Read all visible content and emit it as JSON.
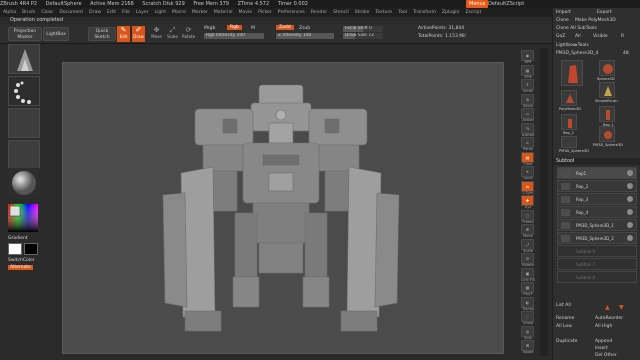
{
  "titlebar": {
    "app": "ZBrush 4R4 P2",
    "document": "DefaultSphere",
    "active_mem": "Active Mem 2168",
    "scratch_disk": "Scratch Disk 929",
    "free_mem": "Free Mem 379",
    "ztime": "ZTime 4.572",
    "timer": "Timer 0.002",
    "menus_button": "Menus",
    "script": "DefaultZScript"
  },
  "menubar": {
    "items": [
      "Alpha",
      "Brush",
      "Color",
      "Document",
      "Draw",
      "Edit",
      "File",
      "Layer",
      "Light",
      "Macro",
      "Marker",
      "Material",
      "Movie",
      "Picker",
      "Preferences",
      "Render",
      "Stencil",
      "Stroke",
      "Texture",
      "Tool",
      "Transform",
      "Zplugin",
      "Zscript"
    ]
  },
  "status": "Operation completed",
  "toolbar": {
    "projection_master": "Projection Master",
    "lightbox": "LightBox",
    "quick_sketch": "Quick Sketch",
    "edit": "Edit",
    "draw": "Draw",
    "move": "Move",
    "scale": "Scale",
    "rotate": "Rotate",
    "mrgb": "Mrgb",
    "rgb": "Rgb",
    "m": "M",
    "rgb_intensity": "Rgb Intensity 100",
    "rgb_intensity_value": 100,
    "zadd": "Zadd",
    "zsub": "Zsub",
    "z_intensity": "Z Intensity 100",
    "z_intensity_value": 100,
    "focal_shift": "Focal Shift 0",
    "draw_size": "Draw Size 72",
    "active_points": "ActivePoints: 31,844",
    "total_points": "TotalPoints: 1.153 Mil"
  },
  "leftshelf": {
    "gradient": "Gradient",
    "switch_color": "SwitchColor",
    "alternate": "Alternate"
  },
  "rightshelf": {
    "items": [
      "BPR",
      "SPix",
      "Scroll",
      "Zoom",
      "Actual",
      "AAHalf",
      "Persp",
      "Floor",
      "Local",
      "L.Sym",
      "Xyz",
      "Frame",
      "Move",
      "Scale",
      "Rotate",
      "Line Fill",
      "PolyF",
      "Transp",
      "Ghost",
      "Solo",
      "Xpose"
    ]
  },
  "tray": {
    "import": "Import",
    "export": "Export",
    "clone": "Clone",
    "make_polymesh": "Make PolyMesh3D",
    "clone_all": "Clone All SubTools",
    "goz": "GoZ",
    "all": "All",
    "visible": "Visible",
    "r": "R",
    "lightbox_tools": "Lightbox▸Tools",
    "current_tool": "PM3D_Sphere3D_4",
    "tool_number": "48",
    "tools": [
      "Sphere3D",
      "SimpleBrush",
      "PolyMesh3D",
      "Rep_1",
      "Rep_2",
      "PM3D_Sphere3D",
      "PM3D_Sphere3D"
    ],
    "subtool": "Subtool",
    "subtools": [
      "Rep1",
      "Rep_2",
      "Rep_3",
      "Rep_4",
      "PM3D_Sphere3D_1",
      "PM3D_Sphere3D_2",
      "Subtool 6",
      "Subtool 7",
      "Subtool 8"
    ],
    "list_all": "List All",
    "rename": "Rename",
    "autoreorder": "AutoReorder",
    "all_low": "All Low",
    "all_high": "All High",
    "duplicate": "Duplicate",
    "append": "Append",
    "insert": "Insert",
    "del_other": "Del Other"
  },
  "colors": {
    "accent": "#d8561a",
    "panel": "#2e2e2e",
    "canvas": "#4b4b4b"
  }
}
